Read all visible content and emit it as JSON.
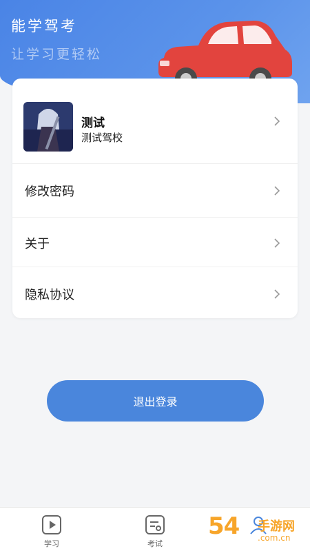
{
  "header": {
    "title": "能学驾考",
    "subtitle": "让学习更轻松"
  },
  "profile": {
    "name": "测试",
    "school": "测试驾校"
  },
  "menu": {
    "items": [
      {
        "label": "修改密码"
      },
      {
        "label": "关于"
      },
      {
        "label": "隐私协议"
      }
    ]
  },
  "logout": {
    "label": "退出登录"
  },
  "tabbar": {
    "items": [
      {
        "label": "学习",
        "icon": "play-icon"
      },
      {
        "label": "考试",
        "icon": "exam-icon"
      },
      {
        "label": "",
        "icon": "user-icon"
      }
    ]
  },
  "watermark": {
    "text": "54",
    "text_cn": "手游网",
    "domain": ".com.cn"
  },
  "colors": {
    "header_blue": "#4a84e6",
    "button_blue": "#4a86dc",
    "car_red": "#e2443e",
    "watermark_orange": "#f7a52a"
  }
}
